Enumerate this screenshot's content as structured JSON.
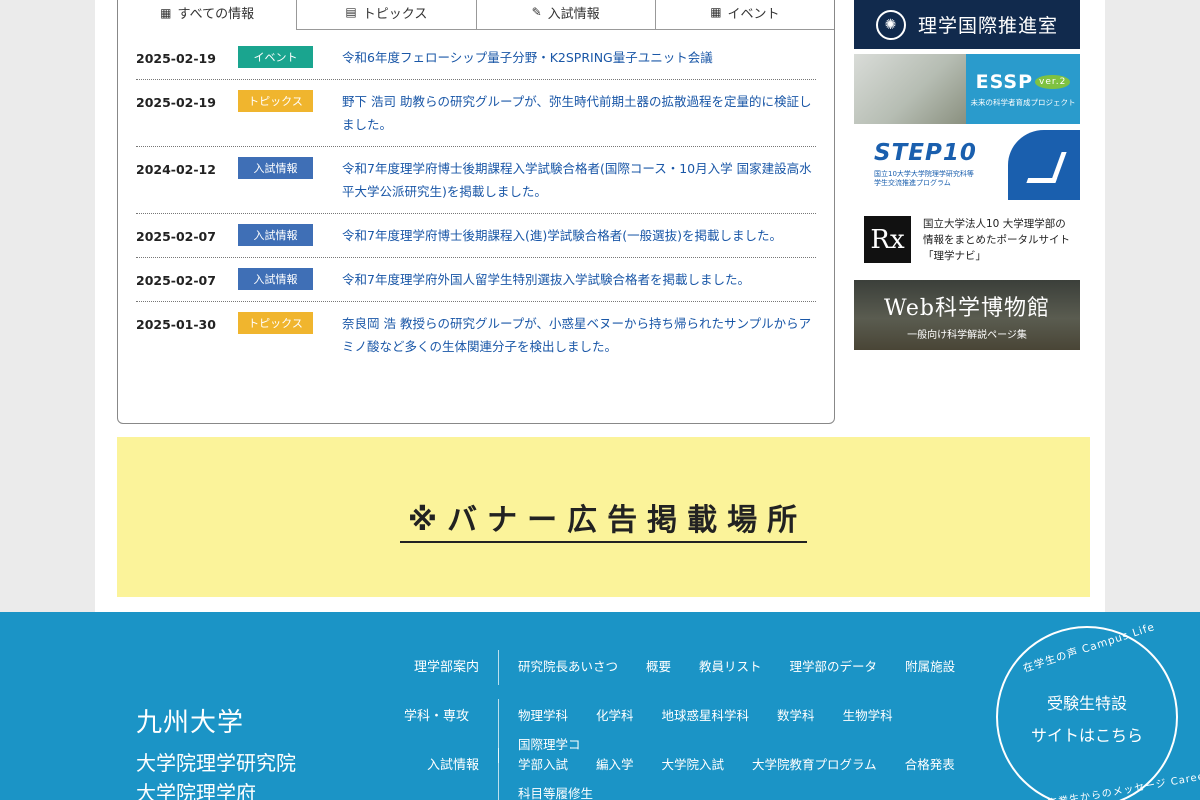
{
  "tabs": [
    {
      "icon": "grid-icon",
      "label": "すべての情報"
    },
    {
      "icon": "newspaper-icon",
      "label": "トピックス"
    },
    {
      "icon": "pencil-icon",
      "label": "入試情報"
    },
    {
      "icon": "calendar-icon",
      "label": "イベント"
    }
  ],
  "news": [
    {
      "date": "2025-02-19",
      "tag": "イベント",
      "tag_color": "#1aa58f",
      "title": "令和6年度フェローシップ量子分野・K2SPRING量子ユニット会議"
    },
    {
      "date": "2025-02-19",
      "tag": "トピックス",
      "tag_color": "#f0b52e",
      "title": "野下 浩司 助教らの研究グループが、弥生時代前期土器の拡散過程を定量的に検証しました。"
    },
    {
      "date": "2024-02-12",
      "tag": "入試情報",
      "tag_color": "#3f6fb6",
      "title": "令和7年度理学府博士後期課程入学試験合格者(国際コース・10月入学 国家建設高水平大学公派研究生)を掲載しました。"
    },
    {
      "date": "2025-02-07",
      "tag": "入試情報",
      "tag_color": "#3f6fb6",
      "title": "令和7年度理学府博士後期課程入(進)学試験合格者(一般選抜)を掲載しました。"
    },
    {
      "date": "2025-02-07",
      "tag": "入試情報",
      "tag_color": "#3f6fb6",
      "title": "令和7年度理学府外国人留学生特別選抜入学試験合格者を掲載しました。"
    },
    {
      "date": "2025-01-30",
      "tag": "トピックス",
      "tag_color": "#f0b52e",
      "title": "奈良岡 浩 教授らの研究グループが、小惑星ベヌーから持ち帰られたサンプルからアミノ酸など多くの生体関連分子を検出しました。"
    }
  ],
  "banners": {
    "intl": "理学国際推進室",
    "essp_big": "ESSP",
    "essp_ver": "ver.2",
    "essp_small": "未来の科学者育成プロジェクト",
    "step_big": "STEP10",
    "step_sub1": "国立10大学大学院理学研究科等",
    "step_sub2": "学生交流推進プログラム",
    "rx_symbol": "Rx",
    "rx_l1": "国立大学法人10 大学理学部の",
    "rx_l2": "情報をまとめたポータルサイト",
    "rx_l3": "「理学ナビ」",
    "web_big": "Web科学博物館",
    "web_small": "一般向け科学解説ページ集"
  },
  "ad": {
    "text": "※バナー広告掲載場所"
  },
  "footer": {
    "university": "九州大学",
    "grad_school_1": "大学院理学研究院",
    "grad_school_2": "大学院理学府",
    "nav": [
      {
        "head": "理学部案内",
        "items": [
          "研究院長あいさつ",
          "概要",
          "教員リスト",
          "理学部のデータ",
          "附属施設"
        ]
      },
      {
        "head": "学科・専攻",
        "items": [
          "物理学科",
          "化学科",
          "地球惑星科学科",
          "数学科",
          "生物学科",
          "国際理学コ"
        ]
      },
      {
        "head": "入試情報",
        "items": [
          "学部入試",
          "編入学",
          "大学院入試",
          "大学院教育プログラム",
          "合格発表",
          "科目等履修生"
        ]
      }
    ],
    "circle": {
      "top": "在学生の声 Campus Life",
      "line1": "受験生特設",
      "line2": "サイトはこちら",
      "bottom": "卒業生からのメッセージ Career Path"
    }
  }
}
